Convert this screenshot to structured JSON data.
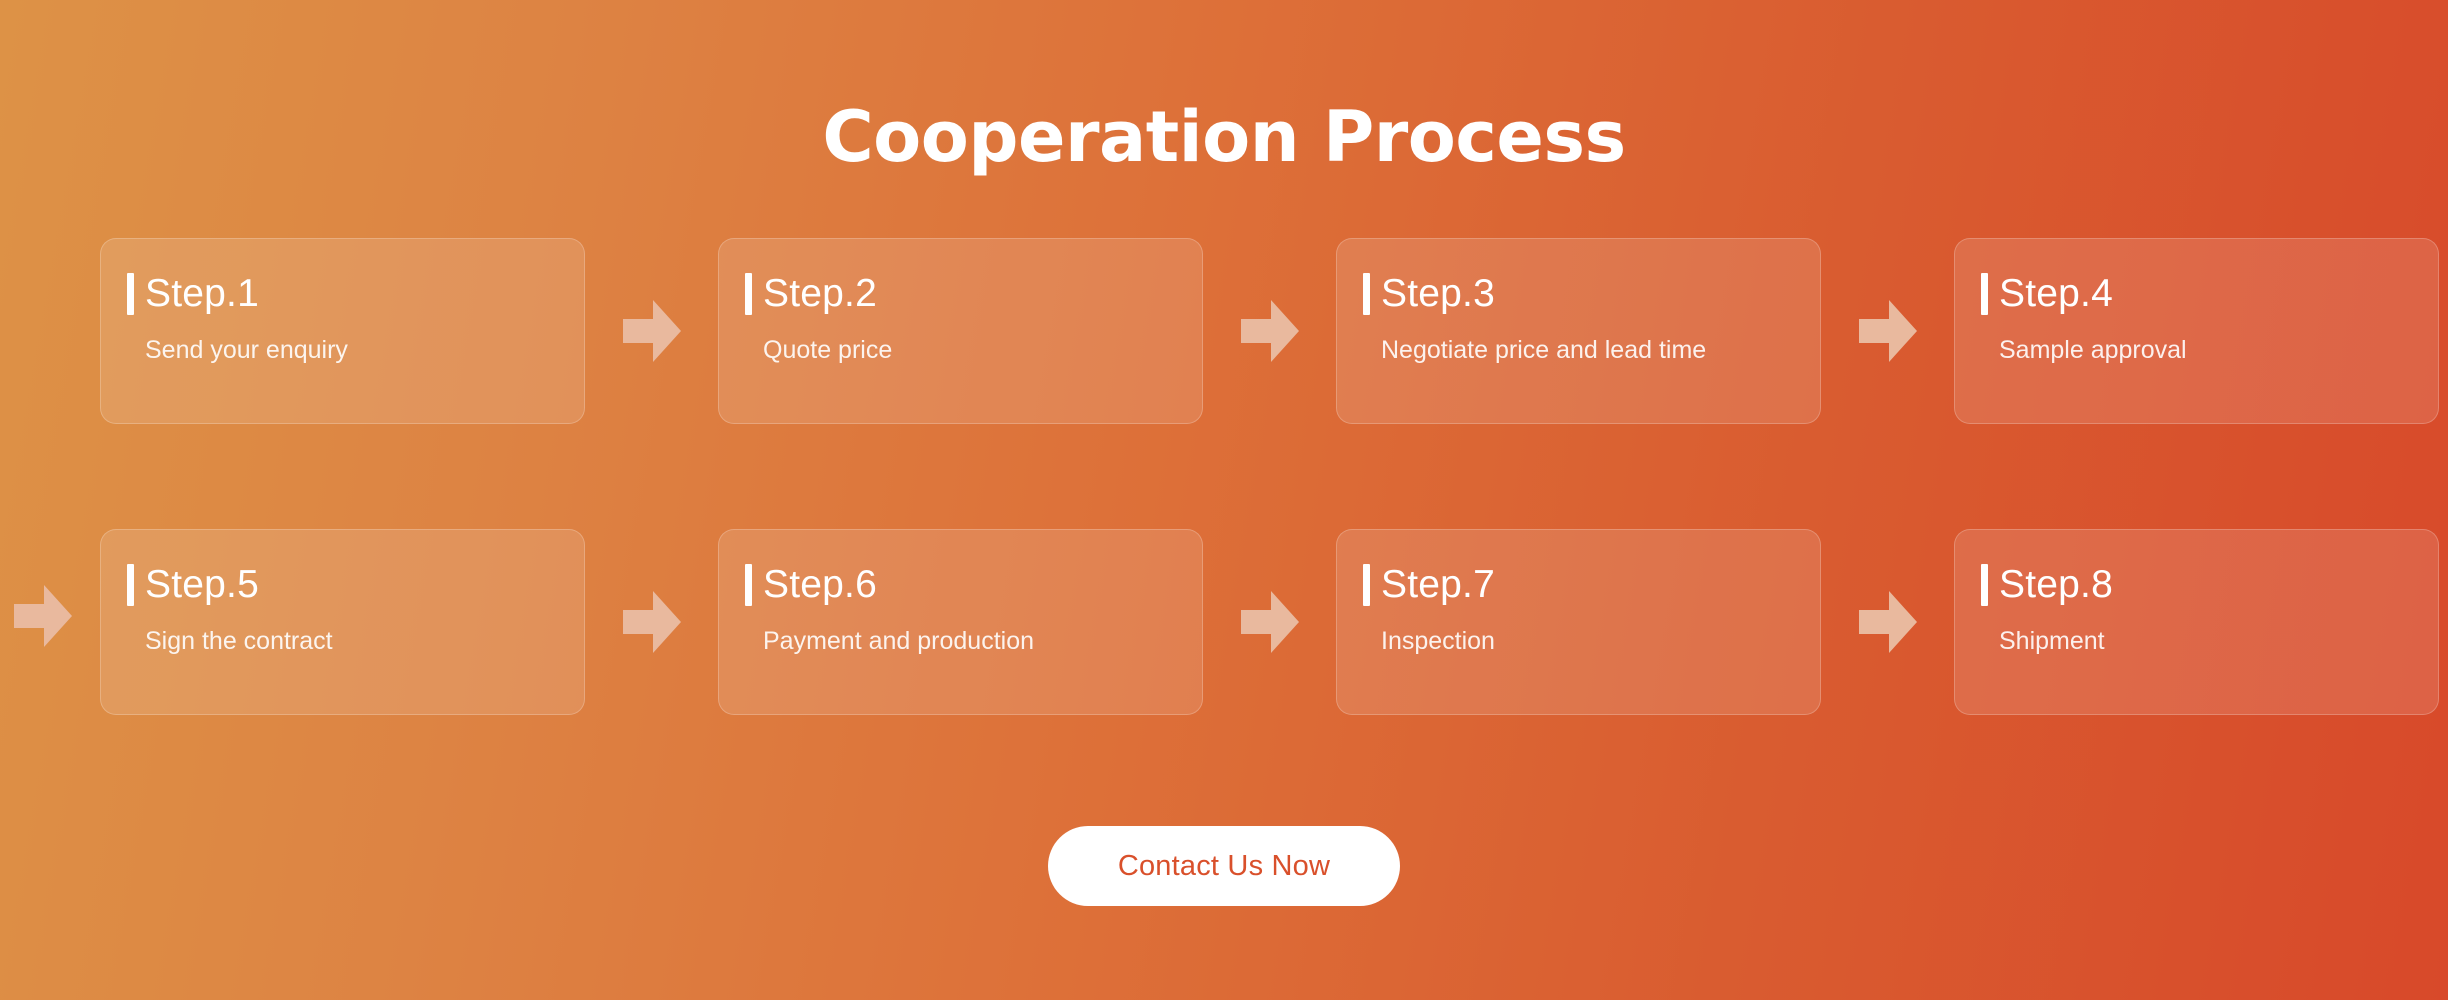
{
  "header": {
    "title": "Cooperation Process"
  },
  "colors": {
    "gradient_start": "#dd9246",
    "gradient_end": "#d8492a",
    "arrow": "#e9b99e",
    "accent_bar": "#ffffff",
    "cta_background": "#ffffff",
    "cta_text": "#d9502b"
  },
  "steps": [
    {
      "label": "Step.1",
      "description": "Send your enquiry"
    },
    {
      "label": "Step.2",
      "description": "Quote price"
    },
    {
      "label": "Step.3",
      "description": "Negotiate price and lead time"
    },
    {
      "label": "Step.4",
      "description": "Sample approval"
    },
    {
      "label": "Step.5",
      "description": "Sign the contract"
    },
    {
      "label": "Step.6",
      "description": "Payment and production"
    },
    {
      "label": "Step.7",
      "description": "Inspection"
    },
    {
      "label": "Step.8",
      "description": "Shipment"
    }
  ],
  "cta": {
    "label": "Contact Us Now"
  }
}
